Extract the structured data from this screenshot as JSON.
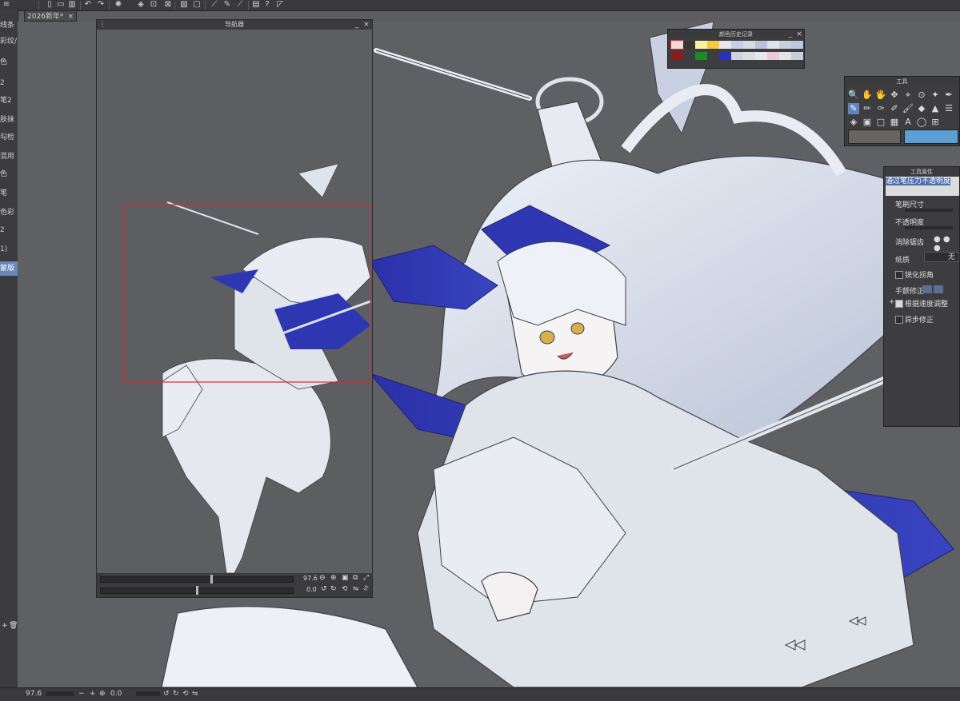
{
  "toolbar": {
    "icons": [
      "menu-icon",
      "new-file-icon",
      "open-folder-icon",
      "save-icon",
      "undo-icon",
      "redo-icon",
      "loading-icon",
      "fill-icon",
      "transform-icon",
      "select-icon",
      "select-invert-icon",
      "deselect-icon",
      "ruler-icon",
      "pen-icon",
      "line-icon",
      "settings-icon",
      "help-icon",
      "ruler-triangle-icon"
    ]
  },
  "document_tab": {
    "label": "2026新年*",
    "close": "×"
  },
  "left_panel": {
    "items": [
      "线条",
      "彩纹/",
      "色",
      "2",
      "笔2",
      "肤抹",
      "勾检",
      "混用",
      "色",
      "笔",
      "色彩",
      "2",
      "1)",
      "蒙版"
    ],
    "selected_index": 13
  },
  "navigator": {
    "title": "导航器",
    "zoom_value": "97.6",
    "rotate_value": "0.0"
  },
  "color_history": {
    "title": "颜色历史记录",
    "swatches_row1": [
      "#f6d9d9",
      "#3c3530",
      "#f5f2a0",
      "#f2cb44",
      "#e7e7ee",
      "#c8d0e6",
      "#d9dce4",
      "#b8c4d8",
      "#dfe2ea",
      "#c9cfdf",
      "#bcc8dd"
    ],
    "swatches_row2": [
      "#8f1c1c",
      "#3d3d3f",
      "#1d8a2a",
      "#3d3d3f",
      "#2a32b8",
      "#cfd4df",
      "#dbdde4",
      "#e6e7ec",
      "#ecc9d8",
      "#e1e4eb",
      "#c7ceda"
    ]
  },
  "tools": {
    "title": "工具",
    "row1": [
      "🔍",
      "✋",
      "🖐",
      "✥",
      "⌖",
      "⊙",
      "✦",
      "✒"
    ],
    "row2": [
      "✎",
      "✏",
      "✑",
      "✐",
      "🖌",
      "◆",
      "▲",
      "☰"
    ],
    "row3": [
      "◈",
      "▣",
      "□",
      "▦",
      "A",
      "◯",
      "⊞",
      ""
    ],
    "main_color": "#686461",
    "sub_color": "#5c9fd6"
  },
  "tool_props": {
    "title": "工具属性",
    "header_text": "通过笔压力不透明度",
    "brush_size": "笔刷尺寸",
    "opacity": "不透明度",
    "antialias": "消除锯齿",
    "paper": "纸质",
    "paper_value": "无",
    "sharpen": "锐化拐角",
    "stabilization": "手颤修正",
    "speed_adjust": "根据速度调整",
    "async": "异步修正"
  },
  "status_bar": {
    "zoom": "97.6",
    "angle": "0.0"
  }
}
